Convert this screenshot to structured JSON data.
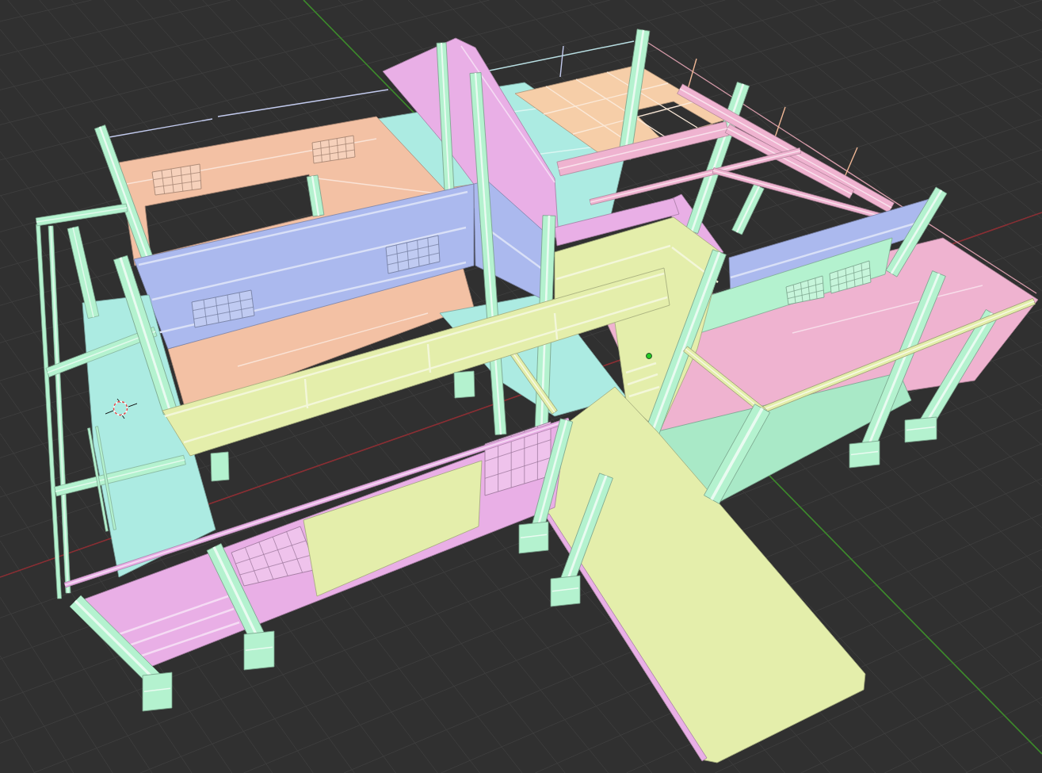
{
  "viewport": {
    "objects": [
      {
        "kind": "wire",
        "color": "#c3cbee"
      },
      {
        "kind": "wire",
        "color": "#c3cbee"
      },
      {
        "kind": "wire",
        "color": "#b9dfe3"
      },
      {
        "kind": "wire",
        "color": "#c3cbee"
      },
      {
        "kind": "wire",
        "color": "#d49aa8"
      },
      {
        "kind": "wire",
        "color": "#f0b896"
      },
      {
        "kind": "wire",
        "color": "#f0b896"
      },
      {
        "kind": "wire",
        "color": "#f0b896"
      },
      {
        "kind": "slab",
        "color": "#acebe2"
      },
      {
        "kind": "slab",
        "color": "#acebe2"
      },
      {
        "kind": "slab",
        "color": "#f6cea8"
      },
      {
        "kind": "slab",
        "color": "#f3c1a4"
      },
      {
        "kind": "post",
        "color": "#b4f2cf"
      },
      {
        "kind": "post",
        "color": "#b4f2cf"
      },
      {
        "kind": "ramp",
        "color": "#e9afe6"
      },
      {
        "kind": "ramp",
        "color": "#e9afe6"
      },
      {
        "kind": "post",
        "color": "#b4f2cf"
      },
      {
        "kind": "post",
        "color": "#b4f2cf"
      },
      {
        "kind": "post",
        "color": "#b4f2cf"
      },
      {
        "kind": "post",
        "color": "#b4f2cf"
      },
      {
        "kind": "frame",
        "color": "#efb3d0"
      },
      {
        "kind": "slab",
        "color": "#f3c1a4"
      },
      {
        "kind": "slab",
        "color": "#acebe2"
      },
      {
        "kind": "slab",
        "color": "#efb3d0"
      },
      {
        "kind": "slab",
        "color": "#a9e9c7"
      },
      {
        "kind": "wall",
        "color": "#abb9ee"
      },
      {
        "kind": "wall",
        "color": "#abb9ee"
      },
      {
        "kind": "wall",
        "color": "#abb9ee"
      },
      {
        "kind": "wall",
        "color": "#b4f2cf"
      },
      {
        "kind": "wall",
        "color": "#e4eeab"
      },
      {
        "kind": "beam",
        "color": "#e9afe6"
      },
      {
        "kind": "post",
        "color": "#b4f2cf"
      },
      {
        "kind": "post",
        "color": "#b4f2cf"
      },
      {
        "kind": "post",
        "color": "#b4f2cf"
      },
      {
        "kind": "post",
        "color": "#b4f2cf"
      },
      {
        "kind": "post",
        "color": "#b4f2cf"
      },
      {
        "kind": "post",
        "color": "#b4f2cf"
      },
      {
        "kind": "rail",
        "color": "#e4eeab"
      },
      {
        "kind": "rail",
        "color": "#e4eeab"
      },
      {
        "kind": "rail",
        "color": "#e4eeab"
      },
      {
        "kind": "walkway",
        "color": "#e4eeab"
      },
      {
        "kind": "edge",
        "color": "#e9afe6"
      },
      {
        "kind": "post",
        "color": "#b4f2cf"
      },
      {
        "kind": "slab",
        "color": "#acebe2"
      },
      {
        "kind": "frame",
        "color": "#b4f2cf"
      },
      {
        "kind": "post",
        "color": "#b4f2cf"
      },
      {
        "kind": "wall",
        "color": "#e4eeab"
      },
      {
        "kind": "base",
        "color": "#b4f2cf"
      },
      {
        "kind": "base",
        "color": "#b4f2cf"
      },
      {
        "kind": "wall",
        "color": "#e9afe6"
      },
      {
        "kind": "wall",
        "color": "#e4eeab"
      },
      {
        "kind": "post",
        "color": "#b4f2cf"
      },
      {
        "kind": "post",
        "color": "#b4f2cf"
      },
      {
        "kind": "post",
        "color": "#b4f2cf"
      },
      {
        "kind": "post",
        "color": "#b4f2cf"
      }
    ]
  }
}
